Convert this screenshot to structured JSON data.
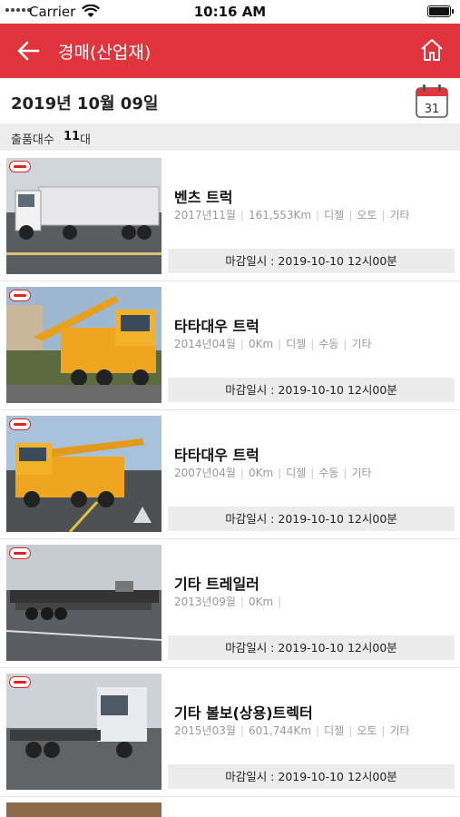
{
  "status_bar": {
    "carrier": "Carrier",
    "time": "10:16 AM"
  },
  "header": {
    "title": "경매(산업재)",
    "back_icon": "back-arrow-icon",
    "home_icon": "home-icon",
    "bg_color": "#e1353d"
  },
  "date_row": {
    "date": "2019년 10월 09일",
    "calendar_day": "31"
  },
  "count_row": {
    "label": "출품대수",
    "count": "11",
    "unit": "대"
  },
  "items": [
    {
      "title": "벤츠 트럭",
      "year": "2017년11월",
      "mileage": "161,553Km",
      "fuel": "디젤",
      "transmission": "오토",
      "etc": "기타",
      "deadline": "마감일시 : 2019-10-10 12시00분"
    },
    {
      "title": "타타대우 트럭",
      "year": "2014년04월",
      "mileage": "0Km",
      "fuel": "디젤",
      "transmission": "수동",
      "etc": "기타",
      "deadline": "마감일시 : 2019-10-10 12시00분"
    },
    {
      "title": "타타대우 트럭",
      "year": "2007년04월",
      "mileage": "0Km",
      "fuel": "디젤",
      "transmission": "수동",
      "etc": "기타",
      "deadline": "마감일시 : 2019-10-10 12시00분"
    },
    {
      "title": "기타 트레일러",
      "year": "2013년09월",
      "mileage": "0Km",
      "fuel": "",
      "transmission": "",
      "etc": "",
      "deadline": "마감일시 : 2019-10-10 12시00분"
    },
    {
      "title": "기타 볼보(상용)트렉터",
      "year": "2015년03월",
      "mileage": "601,744Km",
      "fuel": "디젤",
      "transmission": "오토",
      "etc": "기타",
      "deadline": "마감일시 : 2019-10-10 12시00분"
    }
  ]
}
